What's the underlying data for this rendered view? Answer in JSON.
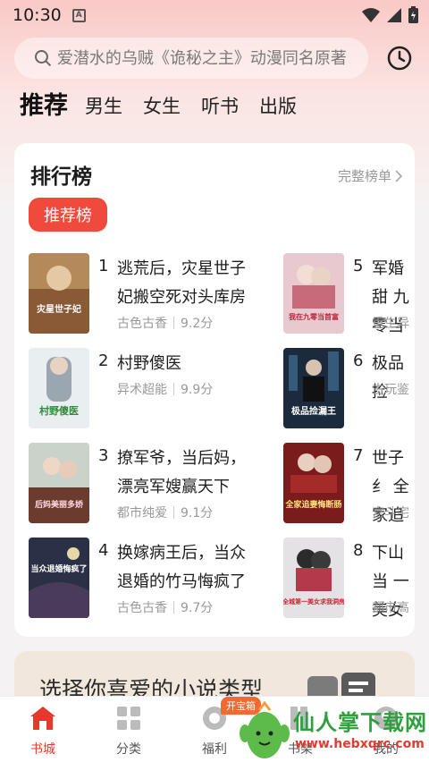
{
  "status": {
    "time": "10:30",
    "a_icon": "A"
  },
  "search": {
    "placeholder": "爱潜水的乌贼《诡秘之主》动漫同名原著"
  },
  "tabs": [
    "推荐",
    "男生",
    "女生",
    "听书",
    "出版"
  ],
  "rank": {
    "title": "排行榜",
    "more": "完整榜单",
    "pill": "推荐榜",
    "books": [
      {
        "rank": "1",
        "title": "逃荒后，灾星世子妃搬空死对头库房",
        "genre": "古色古香",
        "score": "9.2分"
      },
      {
        "rank": "2",
        "title": "村野傻医",
        "genre": "异术超能",
        "score": "9.9分"
      },
      {
        "rank": "3",
        "title": "撩军爷，当后妈，漂亮军嫂赢天下",
        "genre": "都市纯爱",
        "score": "9.1分"
      },
      {
        "rank": "4",
        "title": "换嫁病王后，当众退婚的竹马悔疯了",
        "genre": "古色古香",
        "score": "9.7分"
      },
      {
        "rank": "5",
        "title": "军婚甜 九零当",
        "genre": "重生异",
        "score": ""
      },
      {
        "rank": "6",
        "title": "极品捡",
        "genre": "古玩鉴",
        "score": ""
      },
      {
        "rank": "7",
        "title": "世子纟 全家追",
        "genre": "宫斗宅",
        "score": ""
      },
      {
        "rank": "8",
        "title": "下山当 一美女",
        "genre": "都市高",
        "score": ""
      }
    ],
    "covers": [
      {
        "text": "灾星世子妃",
        "bg": "#b58a5a"
      },
      {
        "text": "村野傻医",
        "bg": "#e9eef0"
      },
      {
        "text": "后妈美丽多娇",
        "bg": "#c9d3c9"
      },
      {
        "text": "当众退婚悔疯了",
        "bg": "#2a3147"
      },
      {
        "text": "我在九零当首富",
        "bg": "#e8c9cf"
      },
      {
        "text": "极品捡漏王",
        "bg": "#1b2a3c"
      },
      {
        "text": "全家追妻悔断肠",
        "bg": "#7a1c1c"
      },
      {
        "text": "全城第一美女求我洞房",
        "bg": "#e4e2e4"
      }
    ]
  },
  "genre_banner": {
    "text": "选择你喜爱的小说类型"
  },
  "nav": {
    "items": [
      "书城",
      "分类",
      "福利",
      "书架",
      "我的"
    ],
    "badge": "开宝箱",
    "watermark_text": "仙人掌下载网",
    "watermark_url": "www.hebxqrc.com"
  },
  "colors": {
    "accent": "#ef4a3b",
    "watermark_green": "#2f9f3e"
  }
}
